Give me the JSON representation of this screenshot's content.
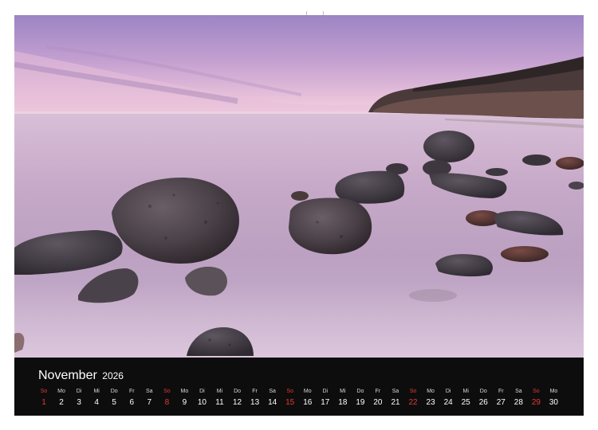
{
  "calendar": {
    "month": "November",
    "year": "2026",
    "days": [
      {
        "wd": "So",
        "num": "1",
        "sunday": true
      },
      {
        "wd": "Mo",
        "num": "2"
      },
      {
        "wd": "Di",
        "num": "3"
      },
      {
        "wd": "Mi",
        "num": "4"
      },
      {
        "wd": "Do",
        "num": "5"
      },
      {
        "wd": "Fr",
        "num": "6"
      },
      {
        "wd": "Sa",
        "num": "7"
      },
      {
        "wd": "So",
        "num": "8",
        "sunday": true
      },
      {
        "wd": "Mo",
        "num": "9"
      },
      {
        "wd": "Di",
        "num": "10"
      },
      {
        "wd": "Mi",
        "num": "11"
      },
      {
        "wd": "Do",
        "num": "12"
      },
      {
        "wd": "Fr",
        "num": "13"
      },
      {
        "wd": "Sa",
        "num": "14"
      },
      {
        "wd": "So",
        "num": "15",
        "sunday": true
      },
      {
        "wd": "Mo",
        "num": "16"
      },
      {
        "wd": "Di",
        "num": "17"
      },
      {
        "wd": "Mi",
        "num": "18"
      },
      {
        "wd": "Do",
        "num": "19"
      },
      {
        "wd": "Fr",
        "num": "20"
      },
      {
        "wd": "Sa",
        "num": "21"
      },
      {
        "wd": "So",
        "num": "22",
        "sunday": true
      },
      {
        "wd": "Mo",
        "num": "23"
      },
      {
        "wd": "Di",
        "num": "24"
      },
      {
        "wd": "Mi",
        "num": "25"
      },
      {
        "wd": "Do",
        "num": "26"
      },
      {
        "wd": "Fr",
        "num": "27"
      },
      {
        "wd": "Sa",
        "num": "28"
      },
      {
        "wd": "So",
        "num": "29",
        "sunday": true
      },
      {
        "wd": "Mo",
        "num": "30"
      }
    ]
  },
  "colors": {
    "sunday": "#e53935",
    "bar_background": "#0d0d0d",
    "sky_top": "#a98ec8",
    "sky_horizon": "#efc6dd",
    "water": "#c7adc9"
  }
}
